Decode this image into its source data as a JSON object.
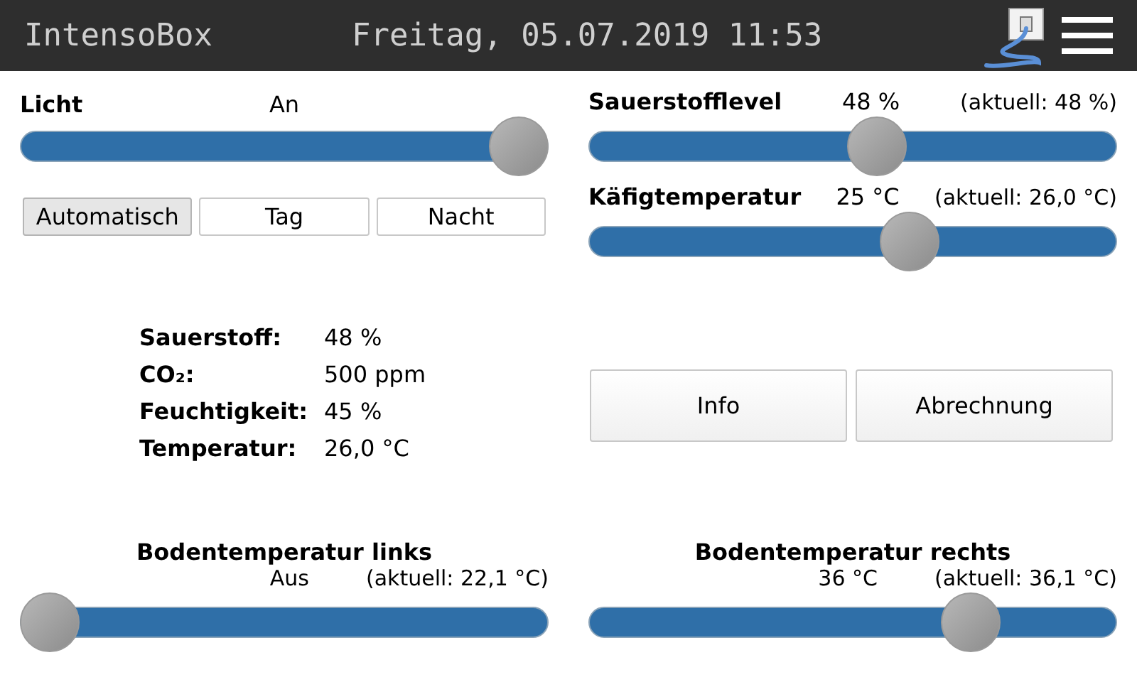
{
  "header": {
    "title": "IntensoBox",
    "datetime": "Freitag, 05.07.2019 11:53"
  },
  "light": {
    "label": "Licht",
    "value": "An",
    "level": 1,
    "modes": [
      {
        "label": "Automatisch",
        "selected": true
      },
      {
        "label": "Tag",
        "selected": false
      },
      {
        "label": "Nacht",
        "selected": false
      }
    ]
  },
  "settings": [
    {
      "label": "Sauerstofflevel",
      "value": "48 %",
      "current": "(aktuell: 48 %)",
      "level": 0.55
    },
    {
      "label": "Käfigtemperatur",
      "value": "25 °C",
      "current": "(aktuell: 26,0 °C)",
      "level": 0.62
    }
  ],
  "readings": [
    {
      "label": "Sauerstoff:",
      "value": "48 %"
    },
    {
      "label": "CO₂:",
      "value": "500 ppm"
    },
    {
      "label": "Feuchtigkeit:",
      "value": "45 %"
    },
    {
      "label": "Temperatur:",
      "value": "26,0 °C"
    }
  ],
  "buttons": [
    "Info",
    "Abrechnung"
  ],
  "floor": [
    {
      "title": "Bodentemperatur links",
      "value": "Aus",
      "current": "(aktuell: 22,1 °C)",
      "level": 0
    },
    {
      "title": "Bodentemperatur rechts",
      "value": "36 °C",
      "current": "(aktuell: 36,1 °C)",
      "level": 0.75
    }
  ]
}
